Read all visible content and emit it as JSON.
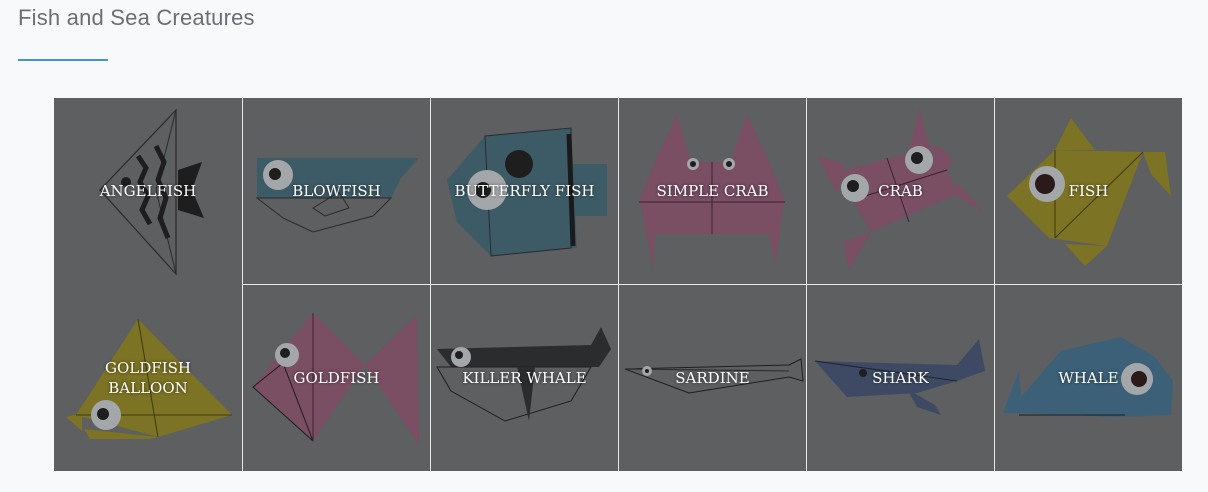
{
  "section": {
    "title": "Fish and Sea Creatures"
  },
  "tiles": [
    {
      "label": "ANGELFISH",
      "icon": "angelfish-icon"
    },
    {
      "label": "BLOWFISH",
      "icon": "blowfish-icon"
    },
    {
      "label": "BUTTERFLY FISH",
      "icon": "butterfly-fish-icon"
    },
    {
      "label": "SIMPLE CRAB",
      "icon": "simple-crab-icon"
    },
    {
      "label": "CRAB",
      "icon": "crab-icon"
    },
    {
      "label": "FISH",
      "icon": "fish-icon"
    },
    {
      "label": "GOLDFISH\nBALLOON",
      "icon": "goldfish-balloon-icon"
    },
    {
      "label": "GOLDFISH",
      "icon": "goldfish-icon"
    },
    {
      "label": "KILLER WHALE",
      "icon": "killer-whale-icon"
    },
    {
      "label": "SARDINE",
      "icon": "sardine-icon"
    },
    {
      "label": "SHARK",
      "icon": "shark-icon"
    },
    {
      "label": "WHALE",
      "icon": "whale-icon"
    }
  ],
  "colors": {
    "accent": "#4a90d9",
    "overlay": "#5d5f61",
    "teal": "#3d5b66",
    "pink": "#7a4e63",
    "olive": "#7c7324",
    "dark": "#2b2c2e",
    "navy": "#3e4a63",
    "blue": "#3b6078"
  }
}
